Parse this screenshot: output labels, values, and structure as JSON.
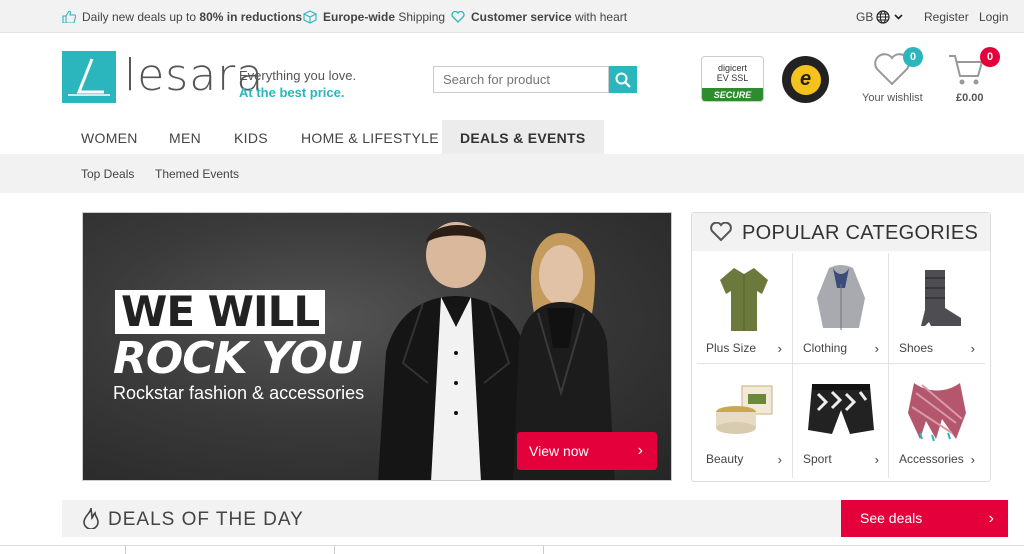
{
  "topbar": {
    "usp1": {
      "pre": "Daily new deals up to ",
      "bold": "80% in reductions"
    },
    "usp2": {
      "bold": "Europe-wide",
      "post": " Shipping"
    },
    "usp3": {
      "bold": "Customer service",
      "post": " with heart"
    },
    "country": "GB",
    "register": "Register",
    "login": "Login"
  },
  "header": {
    "logo": "lesara",
    "tagline1": "Everything you love.",
    "tagline2": "At the best price.",
    "search_placeholder": "Search for product",
    "digicert_top": "digicert",
    "digicert_mid": "EV SSL",
    "digicert_bot": "SECURE",
    "trusted_letter": "e",
    "wishlist_count": "0",
    "wishlist_label": "Your wishlist",
    "cart_count": "0",
    "cart_label": "£0.00"
  },
  "nav": {
    "items": [
      "WOMEN",
      "MEN",
      "KIDS",
      "HOME & LIFESTYLE",
      "DEALS & EVENTS"
    ],
    "sub": [
      "Top Deals",
      "Themed Events"
    ]
  },
  "hero": {
    "line1": "WE WILL",
    "line2": "ROCK YOU",
    "sub": "Rockstar fashion & accessories",
    "cta": "View now"
  },
  "popular": {
    "title": "POPULAR CATEGORIES",
    "categories": [
      {
        "label": "Plus Size",
        "icon": "shirt-icon"
      },
      {
        "label": "Clothing",
        "icon": "jacket-icon"
      },
      {
        "label": "Shoes",
        "icon": "boot-icon"
      },
      {
        "label": "Beauty",
        "icon": "cream-icon"
      },
      {
        "label": "Sport",
        "icon": "shorts-icon"
      },
      {
        "label": "Accessories",
        "icon": "scarf-icon"
      }
    ]
  },
  "deals": {
    "title": "DEALS OF THE DAY",
    "cta": "See deals"
  },
  "colors": {
    "accent": "#2bb6bd",
    "brand_red": "#e4003b"
  }
}
